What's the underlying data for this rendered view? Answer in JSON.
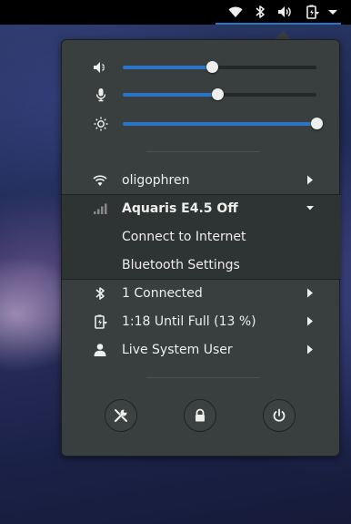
{
  "topbar": {
    "icons": [
      "wifi-icon",
      "bluetooth-icon",
      "volume-icon",
      "battery-charging-icon",
      "chevron-down-icon"
    ]
  },
  "sliders": [
    {
      "icon": "speaker-icon",
      "level": 0.46
    },
    {
      "icon": "microphone-icon",
      "level": 0.49
    },
    {
      "icon": "brightness-icon",
      "level": 1.0
    }
  ],
  "menu": {
    "wifi": {
      "icon": "wifi-icon",
      "label": "oligophren"
    },
    "mobile": {
      "icon": "signal-bars-icon",
      "label": "Aquaris E4.5 Off",
      "items": [
        "Connect to Internet",
        "Bluetooth Settings"
      ]
    },
    "bluetooth": {
      "icon": "bluetooth-icon",
      "label": "1 Connected"
    },
    "battery": {
      "icon": "battery-charging-icon",
      "label": "1:18 Until Full (13 %)"
    },
    "user": {
      "icon": "user-icon",
      "label": "Live System User"
    }
  },
  "buttons": [
    "settings-icon",
    "lock-icon",
    "power-icon"
  ],
  "colors": {
    "accent": "#2a76c6",
    "menu_bg": "#393f3f",
    "text": "#eeeeec"
  }
}
